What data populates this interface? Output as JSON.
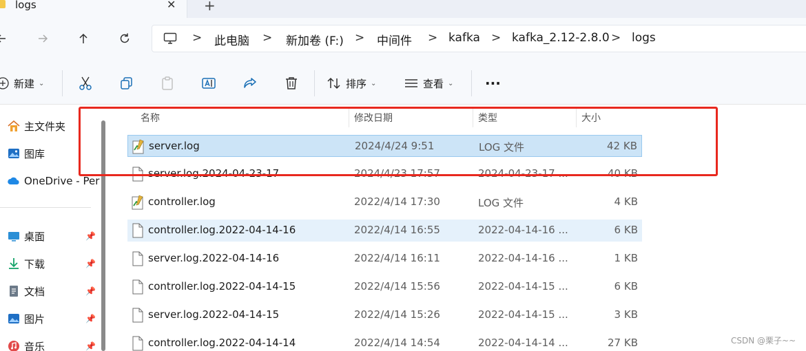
{
  "tab": {
    "title": "logs",
    "close": "✕",
    "new_tab": "+"
  },
  "breadcrumb": {
    "items": [
      "此电脑",
      "新加卷 (F:)",
      "中间件",
      "kafka",
      "kafka_2.12-2.8.0",
      "logs"
    ],
    "separator": ">"
  },
  "toolbar": {
    "new_label": "新建",
    "sort_label": "排序",
    "view_label": "查看",
    "more": "···"
  },
  "sidebar": {
    "items": [
      {
        "label": "主文件夹",
        "icon": "home-icon"
      },
      {
        "label": "图库",
        "icon": "gallery-icon"
      },
      {
        "label": "OneDrive - Per",
        "icon": "onedrive-icon"
      },
      {
        "label": "桌面",
        "icon": "desktop-icon",
        "pinned": true
      },
      {
        "label": "下载",
        "icon": "download-icon",
        "pinned": true
      },
      {
        "label": "文档",
        "icon": "document-icon",
        "pinned": true
      },
      {
        "label": "图片",
        "icon": "pictures-icon",
        "pinned": true
      },
      {
        "label": "音乐",
        "icon": "music-icon",
        "pinned": true
      }
    ],
    "pin_glyph": "📌"
  },
  "columns": {
    "name": "名称",
    "date": "修改日期",
    "type": "类型",
    "size": "大小"
  },
  "files": [
    {
      "name": "server.log",
      "date": "2024/4/24 9:51",
      "type": "LOG 文件",
      "size": "42 KB",
      "icon": "log-file-icon",
      "state": "selected"
    },
    {
      "name": "server.log.2024-04-23-17",
      "date": "2024/4/23 17:57",
      "type": "2024-04-23-17 ...",
      "size": "40 KB",
      "icon": "generic-file-icon",
      "state": "normal"
    },
    {
      "name": "controller.log",
      "date": "2022/4/14 17:30",
      "type": "LOG 文件",
      "size": "4 KB",
      "icon": "log-file-icon",
      "state": "normal"
    },
    {
      "name": "controller.log.2022-04-14-16",
      "date": "2022/4/14 16:55",
      "type": "2022-04-14-16 ...",
      "size": "6 KB",
      "icon": "generic-file-icon",
      "state": "hover"
    },
    {
      "name": "server.log.2022-04-14-16",
      "date": "2022/4/14 16:11",
      "type": "2022-04-14-16 ...",
      "size": "1 KB",
      "icon": "generic-file-icon",
      "state": "normal"
    },
    {
      "name": "controller.log.2022-04-14-15",
      "date": "2022/4/14 15:56",
      "type": "2022-04-14-15 ...",
      "size": "6 KB",
      "icon": "generic-file-icon",
      "state": "normal"
    },
    {
      "name": "server.log.2022-04-14-15",
      "date": "2022/4/14 15:26",
      "type": "2022-04-14-15 ...",
      "size": "3 KB",
      "icon": "generic-file-icon",
      "state": "normal"
    },
    {
      "name": "controller.log.2022-04-14-14",
      "date": "2022/4/14 14:54",
      "type": "2022-04-14-14 ...",
      "size": "27 KB",
      "icon": "generic-file-icon",
      "state": "normal"
    }
  ],
  "colors": {
    "selection": "#cce4f7",
    "hover": "#e5f1fb",
    "annotation": "#e8281e",
    "folder": "#f4c84a"
  },
  "watermark": "CSDN @栗子~~"
}
